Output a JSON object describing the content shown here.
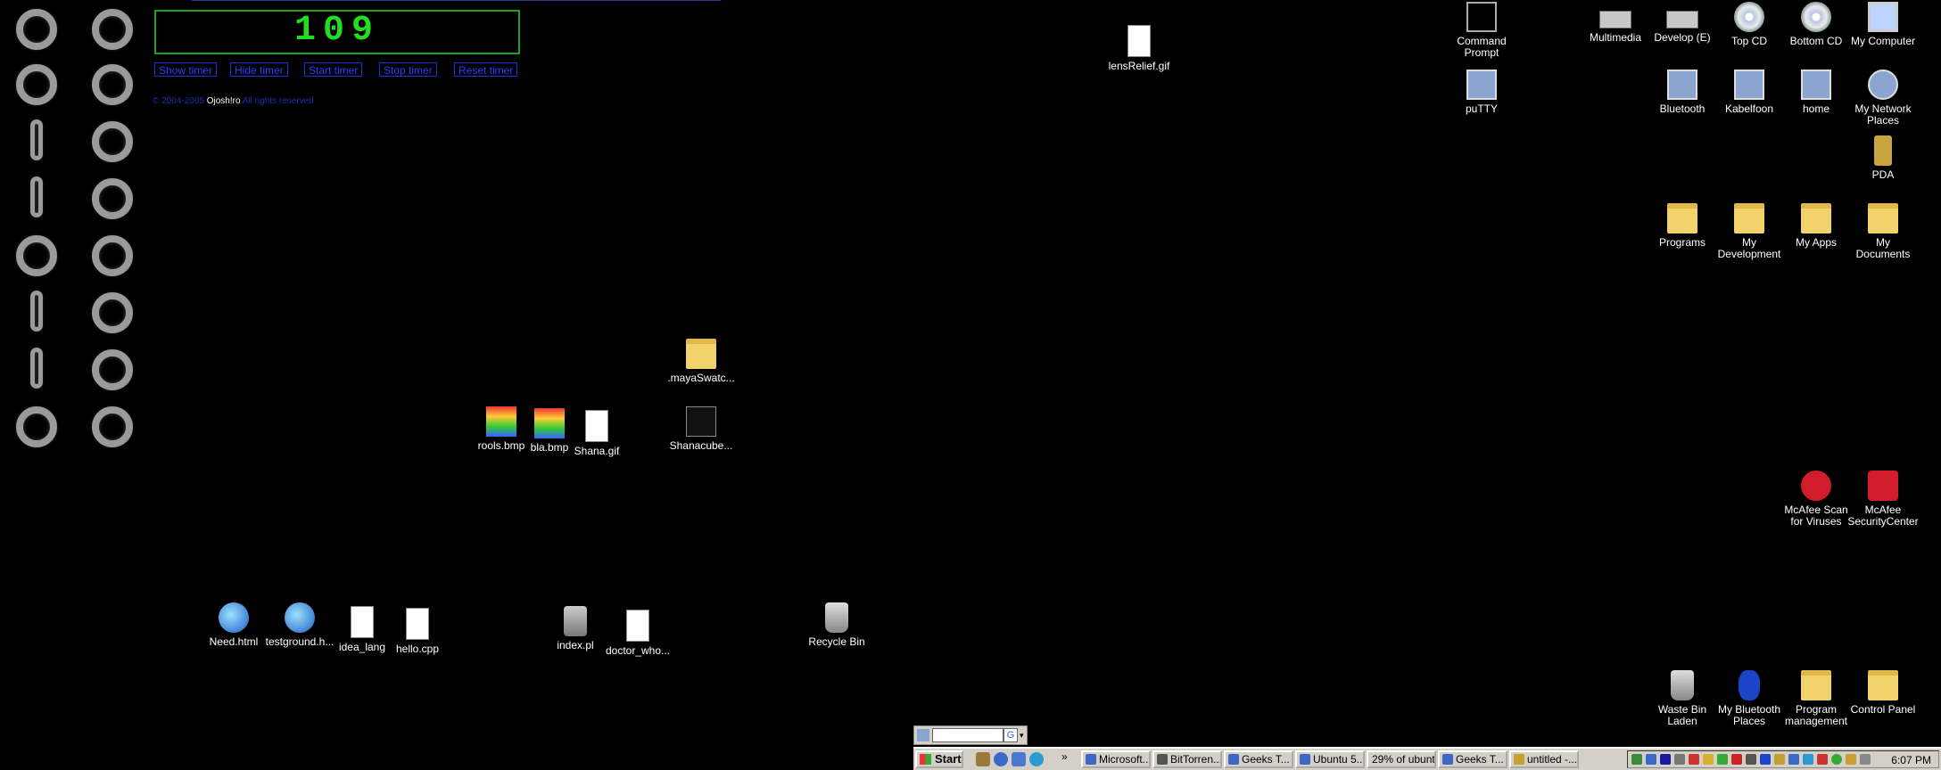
{
  "timer": {
    "value": "109",
    "buttons": [
      "Show timer",
      "Hide timer",
      "Start timer",
      "Stop timer",
      "Reset timer"
    ],
    "copyright_prefix": "© 2004-2005",
    "copyright_name": "Ojosh!ro",
    "copyright_suffix": "All rights reserved"
  },
  "desktop_icons": [
    {
      "label": "lensRelief.gif",
      "icon": "gif-image-icon"
    },
    {
      "label": "Command\nPrompt",
      "icon": "command-prompt-icon"
    },
    {
      "label": "puTTY",
      "icon": "putty-icon"
    },
    {
      "label": "Multimedia",
      "icon": "drive-icon"
    },
    {
      "label": "Develop (E)",
      "icon": "drive-icon"
    },
    {
      "label": "Top CD",
      "icon": "cd-drive-icon"
    },
    {
      "label": "Bottom CD",
      "icon": "cd-drive-icon"
    },
    {
      "label": "My Computer",
      "icon": "my-computer-icon"
    },
    {
      "label": "Bluetooth",
      "icon": "network-drive-icon"
    },
    {
      "label": "Kabelfoon",
      "icon": "network-drive-icon"
    },
    {
      "label": "home",
      "icon": "network-drive-icon"
    },
    {
      "label": "My Network\nPlaces",
      "icon": "network-places-icon"
    },
    {
      "label": "PDA",
      "icon": "pda-icon"
    },
    {
      "label": "Programs",
      "icon": "programs-folder-icon"
    },
    {
      "label": "My\nDevelopment",
      "icon": "folder-icon"
    },
    {
      "label": "My Apps",
      "icon": "folder-icon"
    },
    {
      "label": "My Documents",
      "icon": "my-documents-icon"
    },
    {
      "label": ".mayaSwatc...",
      "icon": "folder-icon"
    },
    {
      "label": "Shanacube...",
      "icon": "maya-file-icon"
    },
    {
      "label": "rools.bmp",
      "icon": "bmp-image-icon"
    },
    {
      "label": "bla.bmp",
      "icon": "bmp-image-icon"
    },
    {
      "label": "Shana.gif",
      "icon": "gif-image-icon"
    },
    {
      "label": "McAfee Scan\nfor Viruses",
      "icon": "mcafee-scan-icon"
    },
    {
      "label": "McAfee\nSecurityCenter",
      "icon": "mcafee-security-icon"
    },
    {
      "label": "Need.html",
      "icon": "html-file-icon"
    },
    {
      "label": "testground.h...",
      "icon": "html-file-icon"
    },
    {
      "label": "idea_lang",
      "icon": "document-icon"
    },
    {
      "label": "hello.cpp",
      "icon": "document-icon"
    },
    {
      "label": "index.pl",
      "icon": "perl-file-icon"
    },
    {
      "label": "doctor_who...",
      "icon": "document-icon"
    },
    {
      "label": "Recycle Bin",
      "icon": "recycle-bin-icon"
    },
    {
      "label": "Waste Bin\nLaden",
      "icon": "recycle-bin-icon"
    },
    {
      "label": "My Bluetooth\nPlaces",
      "icon": "bluetooth-icon"
    },
    {
      "label": "Program\nmanagement",
      "icon": "programs-folder-icon"
    },
    {
      "label": "Control Panel",
      "icon": "control-panel-icon"
    }
  ],
  "taskbar": {
    "start_label": "Start",
    "more_label": "»",
    "tasks": [
      "Microsoft...",
      "BitTorren...",
      "Geeks T...",
      "Ubuntu 5...",
      "29% of ubunt...",
      "Geeks T...",
      "untitled -..."
    ],
    "clock": "6:07 PM"
  },
  "google_bar": {
    "placeholder": "",
    "button": "G"
  }
}
